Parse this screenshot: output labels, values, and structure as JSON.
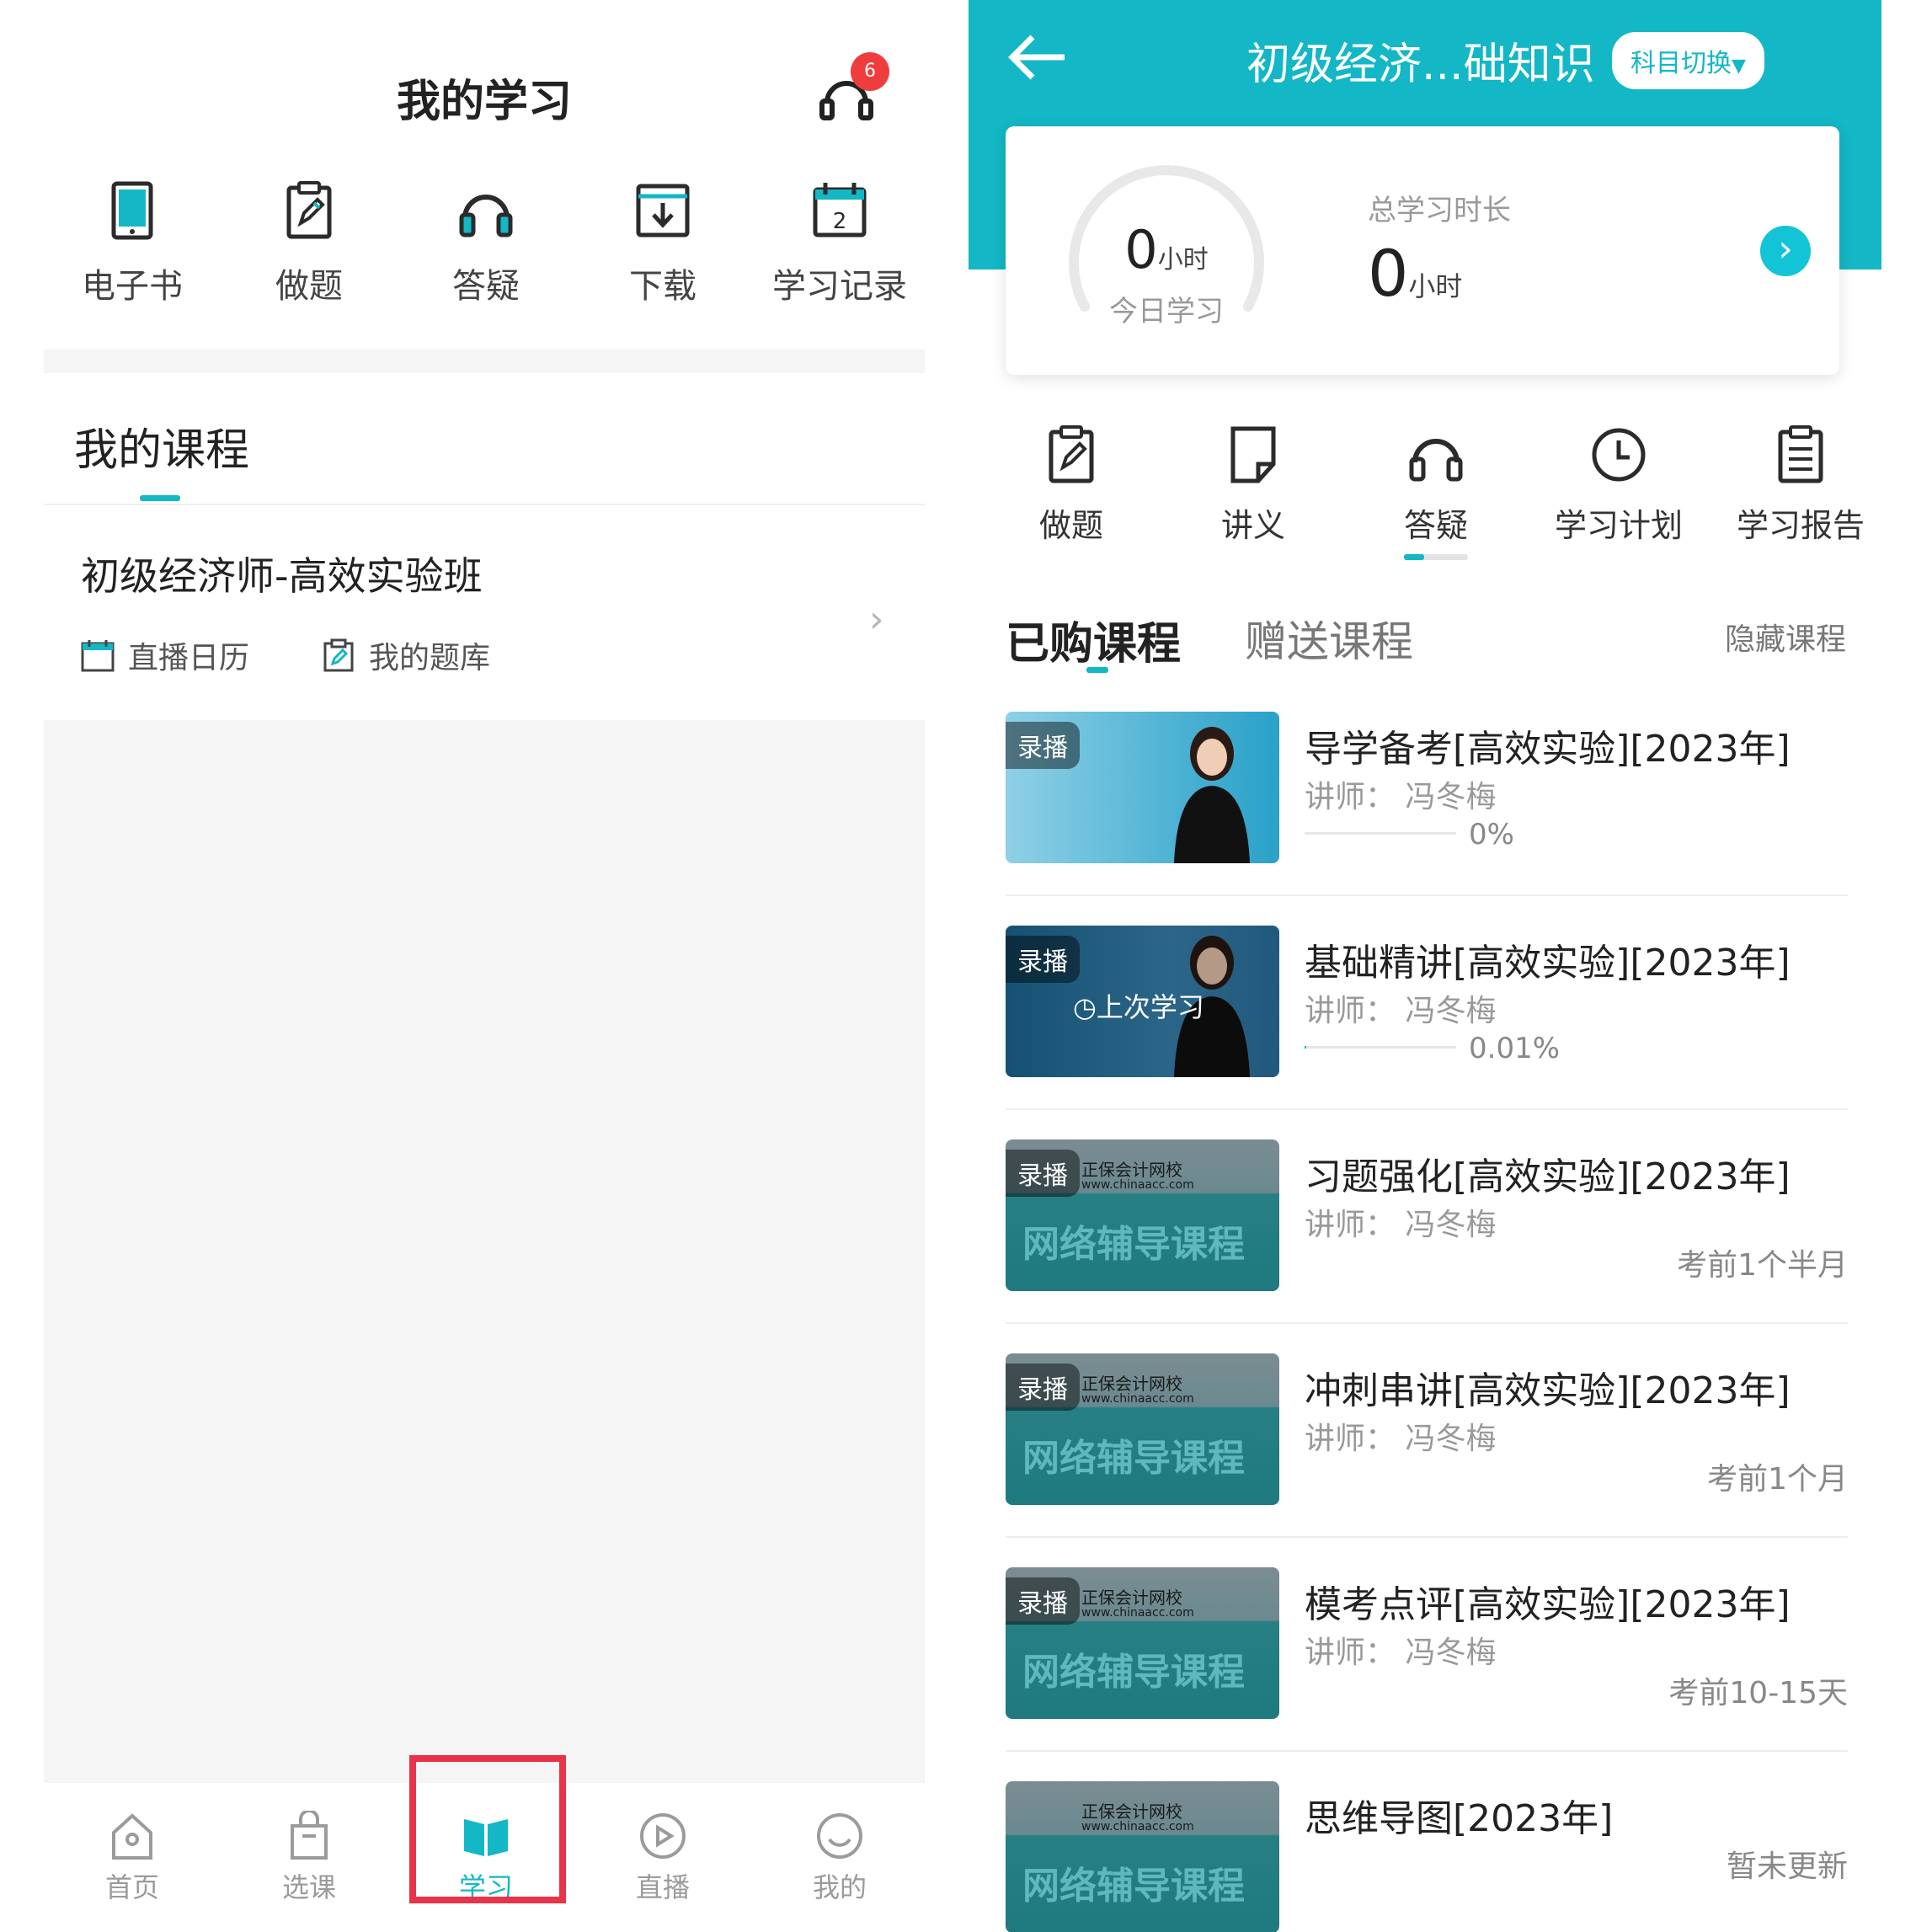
{
  "left": {
    "title": "我的学习",
    "support_badge": "6",
    "quick_actions": [
      {
        "label": "电子书",
        "icon": "ebook-icon"
      },
      {
        "label": "做题",
        "icon": "exercise-icon"
      },
      {
        "label": "答疑",
        "icon": "headset-icon"
      },
      {
        "label": "下载",
        "icon": "download-icon"
      },
      {
        "label": "学习记录",
        "icon": "calendar-icon"
      }
    ],
    "section_title": "我的课程",
    "course_name": "初级经济师-高效实验班",
    "course_links": [
      "直播日历",
      "我的题库"
    ],
    "tabbar": [
      {
        "label": "首页",
        "icon": "home-icon"
      },
      {
        "label": "选课",
        "icon": "bag-icon"
      },
      {
        "label": "学习",
        "icon": "book-icon"
      },
      {
        "label": "直播",
        "icon": "play-icon"
      },
      {
        "label": "我的",
        "icon": "face-icon"
      }
    ],
    "active_tab": "学习",
    "colors": {
      "accent": "#13b7c6",
      "highlight_box": "#e8334a",
      "badge": "#ef3d3d"
    }
  },
  "right": {
    "header_title": "初级经济...础知识",
    "subject_switch": "科目切换",
    "today": {
      "value": "0",
      "unit": "小时",
      "label": "今日学习"
    },
    "total": {
      "label": "总学习时长",
      "value": "0",
      "unit": "小时"
    },
    "quick_actions": [
      {
        "label": "做题",
        "icon": "exercise-icon"
      },
      {
        "label": "讲义",
        "icon": "note-icon"
      },
      {
        "label": "答疑",
        "icon": "headset-icon"
      },
      {
        "label": "学习计划",
        "icon": "clock-icon"
      },
      {
        "label": "学习报告",
        "icon": "report-icon"
      }
    ],
    "tabs": {
      "purchased": "已购课程",
      "gifted": "赠送课程",
      "hidden": "隐藏课程"
    },
    "courses": [
      {
        "title": "导学备考[高效实验][2023年]",
        "teacher": "讲师：  冯冬梅",
        "tag": "录播",
        "progress_text": "0%",
        "progress": 0
      },
      {
        "title": "基础精讲[高效实验][2023年]",
        "teacher": "讲师：  冯冬梅",
        "tag": "录播",
        "progress_text": "0.01%",
        "progress": 0.0001,
        "overlay": "上次学习"
      },
      {
        "title": "习题强化[高效实验][2023年]",
        "teacher": "讲师：  冯冬梅",
        "tag": "录播",
        "schedule": "考前1个半月"
      },
      {
        "title": "冲刺串讲[高效实验][2023年]",
        "teacher": "讲师：  冯冬梅",
        "tag": "录播",
        "schedule": "考前1个月"
      },
      {
        "title": "模考点评[高效实验][2023年]",
        "teacher": "讲师：  冯冬梅",
        "tag": "录播",
        "schedule": "考前10-15天"
      },
      {
        "title": "思维导图[2023年]",
        "schedule": "暂未更新"
      }
    ],
    "thumbnail": {
      "brand": "正保会计网校",
      "url": "www.chinaacc.com",
      "caption": "网络辅导课程"
    }
  }
}
